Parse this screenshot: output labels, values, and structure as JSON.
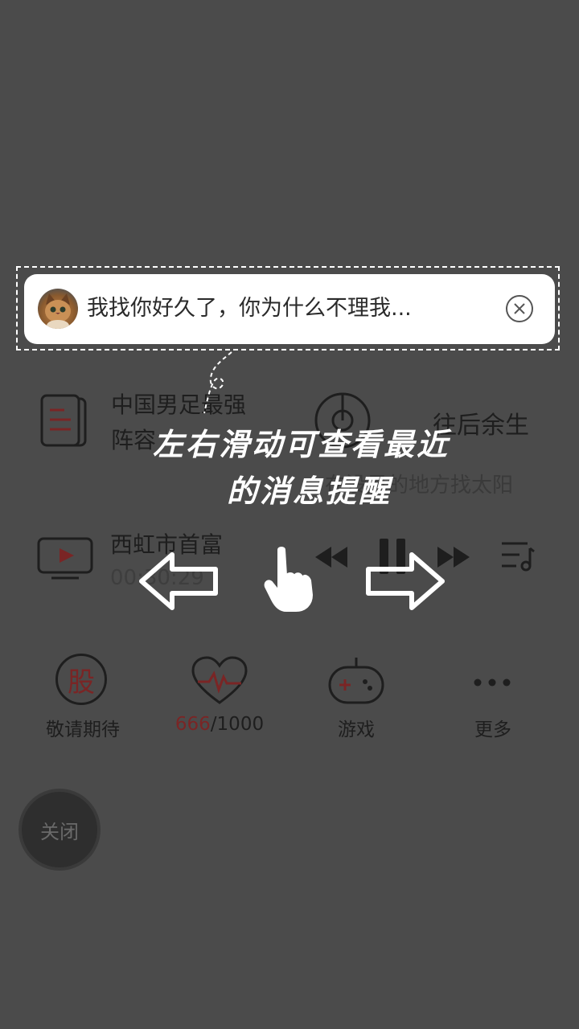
{
  "notification": {
    "message": "我找你好久了，你为什么不理我..."
  },
  "news": {
    "title_line1": "中国男足最强",
    "title_line2": "阵容"
  },
  "music": {
    "song": "往后余生",
    "lyric": "在没风的地方找太阳"
  },
  "video": {
    "title": "西虹市首富",
    "time": "00:30:29"
  },
  "guide": {
    "line1": "左右滑动可查看最近",
    "line2": "的消息提醒"
  },
  "grid": {
    "stock": {
      "icon_char": "股",
      "label": "敬请期待"
    },
    "health": {
      "value": "666",
      "total": "/1000"
    },
    "game": {
      "label": "游戏"
    },
    "more": {
      "label": "更多"
    }
  },
  "close_button": {
    "label": "关闭"
  },
  "colors": {
    "overlay_bg": "#4b4b4b",
    "accent_red": "#8a2a2a",
    "white": "#ffffff"
  }
}
